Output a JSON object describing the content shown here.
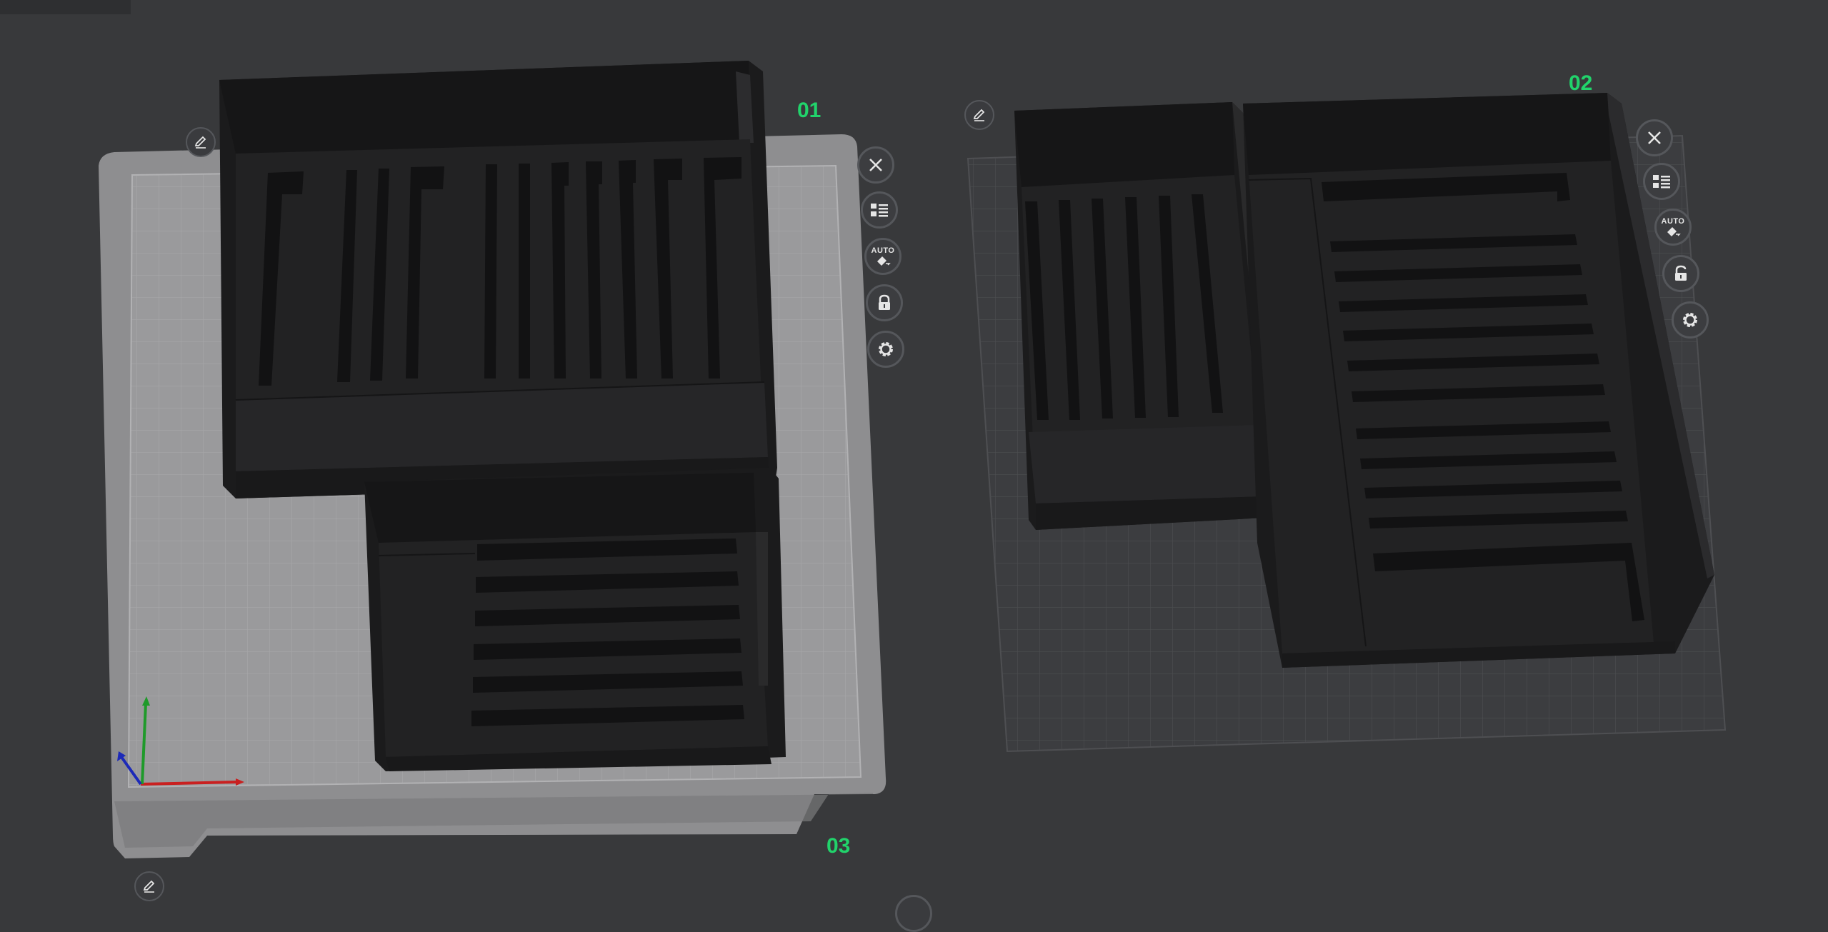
{
  "plates": {
    "p1": {
      "label": "01"
    },
    "p2": {
      "label": "02"
    },
    "p3": {
      "label": "03"
    }
  },
  "toolbar_p1": {
    "close": {
      "icon": "close-icon"
    },
    "arrange": {
      "icon": "list-arrange-icon"
    },
    "auto": {
      "text": "AUTO",
      "icon": "auto-orient-icon"
    },
    "lock": {
      "icon": "lock-icon"
    },
    "settings": {
      "icon": "gear-icon"
    }
  },
  "toolbar_p2": {
    "close": {
      "icon": "close-icon"
    },
    "arrange": {
      "icon": "list-arrange-icon"
    },
    "auto": {
      "text": "AUTO",
      "icon": "auto-orient-icon"
    },
    "lock": {
      "icon": "unlock-icon"
    },
    "settings": {
      "icon": "gear-icon"
    }
  },
  "colors": {
    "background": "#38393b",
    "plate": "#8c8c8e",
    "grid": "#a9a9ab",
    "model": "#242425",
    "label": "#21d36b"
  }
}
